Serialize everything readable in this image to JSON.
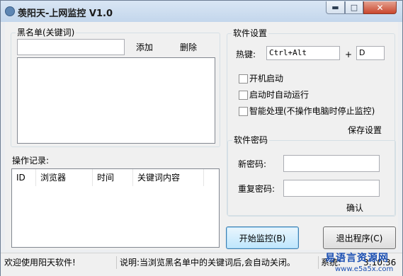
{
  "window": {
    "title": "羡阳天-上网监控 V1.0",
    "minimize_icon": "minimize-icon",
    "maximize_icon": "maximize-icon",
    "close_icon": "close-icon"
  },
  "blacklist": {
    "group_title": "黑名单(关键词)",
    "input_value": "",
    "add_label": "添加",
    "delete_label": "删除"
  },
  "log": {
    "label": "操作记录:",
    "columns": [
      "ID",
      "浏览器",
      "时间",
      "关键词内容"
    ],
    "rows": []
  },
  "settings": {
    "group_title": "软件设置",
    "hotkey_label": "热键:",
    "hotkey_modifier": "Ctrl+Alt",
    "plus": "+",
    "hotkey_key": "D",
    "checkboxes": [
      {
        "label": "开机启动",
        "checked": false
      },
      {
        "label": "启动时自动运行",
        "checked": false
      },
      {
        "label": "智能处理(不操作电脑时停止监控)",
        "checked": false
      }
    ],
    "save_label": "保存设置"
  },
  "password": {
    "group_title": "软件密码",
    "new_label": "新密码:",
    "repeat_label": "重复密码:",
    "new_value": "",
    "repeat_value": "",
    "confirm_label": "确认"
  },
  "actions": {
    "start_label": "开始监控(B)",
    "exit_label": "退出程序(C)"
  },
  "status": {
    "welcome": "欢迎使用阳天软件!",
    "note": "说明:当浏览黑名单中的关键词后,会自动关闭。",
    "right": "系统:",
    "time": "3:10:36"
  },
  "watermark": {
    "text": "易语言资源网",
    "url": "www.e5a5x.com"
  },
  "colors": {
    "focus_button": "#bee6fd",
    "close_button": "#c9462c",
    "watermark": "#1a4fb3"
  }
}
